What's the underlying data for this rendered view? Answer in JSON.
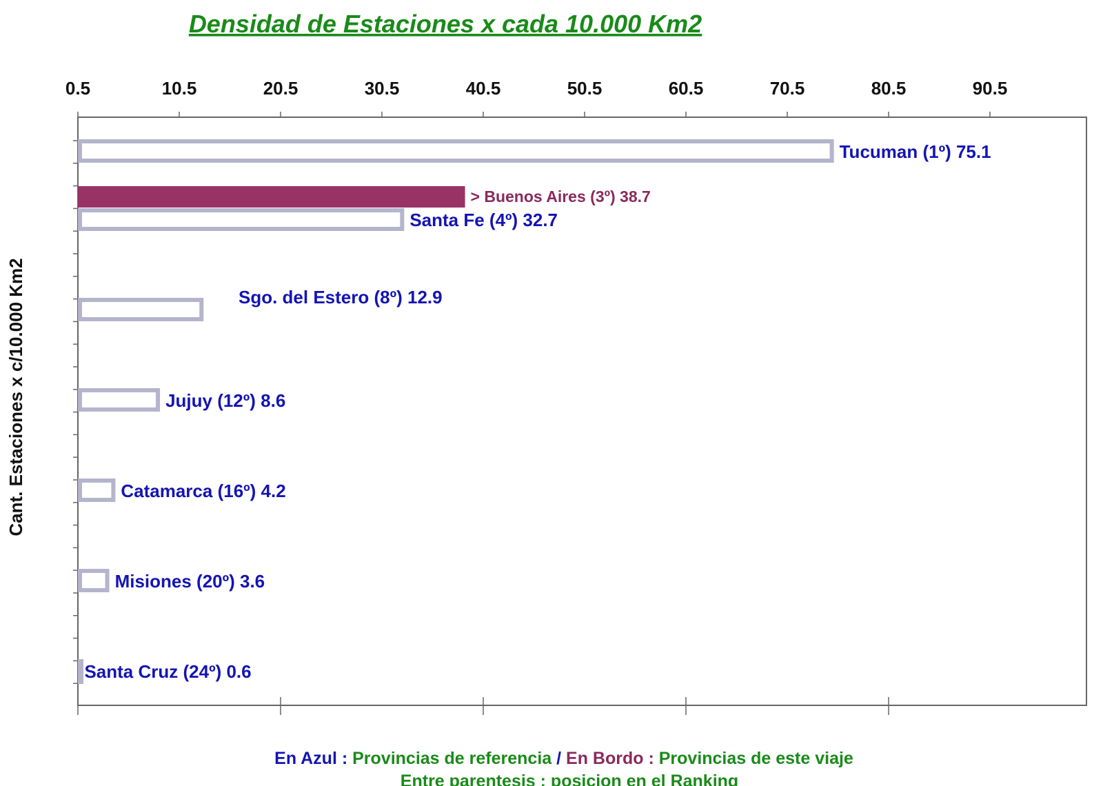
{
  "colors": {
    "title": "#1a8a1a",
    "reference_label": "#1414b4",
    "trip_label": "#8a2a5c",
    "trip_bar_fill": "#993366",
    "reference_bar_stroke": "#b4b4cc",
    "axis": "#666666",
    "legend_green": "#1a8a1a"
  },
  "chart_data": {
    "type": "bar",
    "orientation": "horizontal",
    "title": "Densidad de Estaciones x cada 10.000 Km2",
    "xlabel": "",
    "ylabel": "Cant. Estaciones x c/10.000 Km2",
    "xlim": [
      0.5,
      100
    ],
    "x_ticks": [
      "0.5",
      "10.5",
      "20.5",
      "30.5",
      "40.5",
      "50.5",
      "60.5",
      "70.5",
      "80.5",
      "90.5"
    ],
    "x_axis_position": "top",
    "grid": false,
    "bars": [
      {
        "province": "Tucuman",
        "rank": 1,
        "value": 75.1,
        "label": "Tucuman (1º) 75.1",
        "group": "reference"
      },
      {
        "province": "Buenos Aires",
        "rank": 3,
        "value": 38.7,
        "label": "> Buenos Aires (3º) 38.7",
        "group": "trip"
      },
      {
        "province": "Santa Fe",
        "rank": 4,
        "value": 32.7,
        "label": "Santa Fe (4º) 32.7",
        "group": "reference"
      },
      {
        "province": "Sgo. del Estero",
        "rank": 8,
        "value": 12.9,
        "label": "Sgo. del Estero (8º) 12.9",
        "group": "reference"
      },
      {
        "province": "Jujuy",
        "rank": 12,
        "value": 8.6,
        "label": "Jujuy (12º) 8.6",
        "group": "reference"
      },
      {
        "province": "Catamarca",
        "rank": 16,
        "value": 4.2,
        "label": "Catamarca (16º) 4.2",
        "group": "reference"
      },
      {
        "province": "Misiones",
        "rank": 20,
        "value": 3.6,
        "label": "Misiones (20º) 3.6",
        "group": "reference"
      },
      {
        "province": "Santa Cruz",
        "rank": 24,
        "value": 0.6,
        "label": "Santa Cruz (24º) 0.6",
        "group": "reference"
      }
    ],
    "legend": {
      "line1": [
        {
          "text": "En Azul",
          "color_key": "reference_label"
        },
        {
          "text": " : ",
          "color_key": "reference_label"
        },
        {
          "text": "Provincias de referencia",
          "color_key": "legend_green"
        },
        {
          "text": " / ",
          "color_key": "reference_label"
        },
        {
          "text": "En Bordo",
          "color_key": "trip_label"
        },
        {
          "text": " : ",
          "color_key": "trip_label"
        },
        {
          "text": "Provincias de este viaje",
          "color_key": "legend_green"
        }
      ],
      "line2": "Entre parentesis : posicion en el Ranking",
      "placement": "bottom-center"
    }
  }
}
